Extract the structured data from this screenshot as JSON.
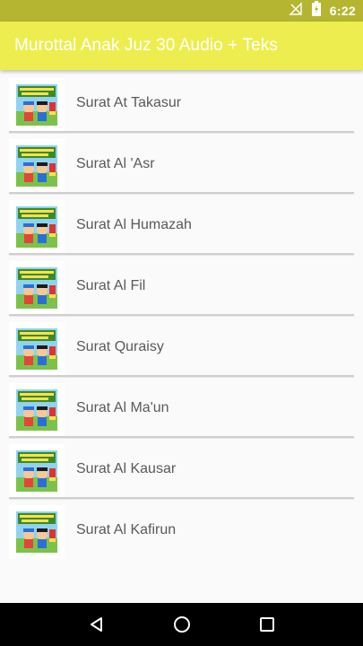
{
  "status_bar": {
    "time": "6:22",
    "icons": [
      "signal-off-icon",
      "battery-icon"
    ]
  },
  "app_bar": {
    "title": "Murottal Anak Juz 30 Audio + Teks"
  },
  "list": {
    "items": [
      {
        "label": "Surat At Takasur",
        "icon": "surah-thumbnail-icon"
      },
      {
        "label": "Surat Al 'Asr",
        "icon": "surah-thumbnail-icon"
      },
      {
        "label": "Surat Al Humazah",
        "icon": "surah-thumbnail-icon"
      },
      {
        "label": "Surat Al Fil",
        "icon": "surah-thumbnail-icon"
      },
      {
        "label": "Surat Quraisy",
        "icon": "surah-thumbnail-icon"
      },
      {
        "label": "Surat Al Ma'un",
        "icon": "surah-thumbnail-icon"
      },
      {
        "label": "Surat Al Kausar",
        "icon": "surah-thumbnail-icon"
      },
      {
        "label": "Surat Al Kafirun",
        "icon": "surah-thumbnail-icon"
      }
    ]
  },
  "nav_bar": {
    "buttons": [
      "back-icon",
      "home-icon",
      "recents-icon"
    ]
  },
  "colors": {
    "status_bar": "#b5b532",
    "app_bar": "#eded50",
    "nav_bar": "#000000"
  }
}
